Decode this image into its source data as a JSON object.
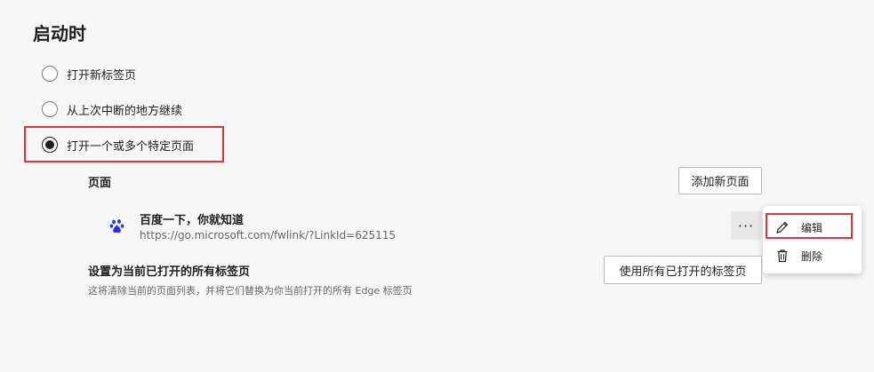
{
  "page": {
    "title": "启动时"
  },
  "startup_options": [
    {
      "label": "打开新标签页",
      "checked": false
    },
    {
      "label": "从上次中断的地方继续",
      "checked": false
    },
    {
      "label": "打开一个或多个特定页面",
      "checked": true
    }
  ],
  "pages_section": {
    "label": "页面",
    "add_button_label": "添加新页面",
    "entries": [
      {
        "name": "百度一下，你就知道",
        "url": "https://go.microsoft.com/fwlink/?LinkId=625115",
        "icon": "baidu-paw-icon"
      }
    ],
    "more_button_label": "···"
  },
  "context_menu": {
    "items": [
      {
        "label": "编辑",
        "icon": "pencil-icon"
      },
      {
        "label": "删除",
        "icon": "trash-icon"
      }
    ]
  },
  "use_open_tabs": {
    "title": "设置为当前已打开的所有标签页",
    "description": "这将清除当前的页面列表，并将它们替换为你当前打开的所有 Edge 标签页",
    "button_label": "使用所有已打开的标签页"
  },
  "colors": {
    "background": "#f7f7f7",
    "highlight_border": "#d9363e",
    "baidu_blue": "#2932e1"
  }
}
